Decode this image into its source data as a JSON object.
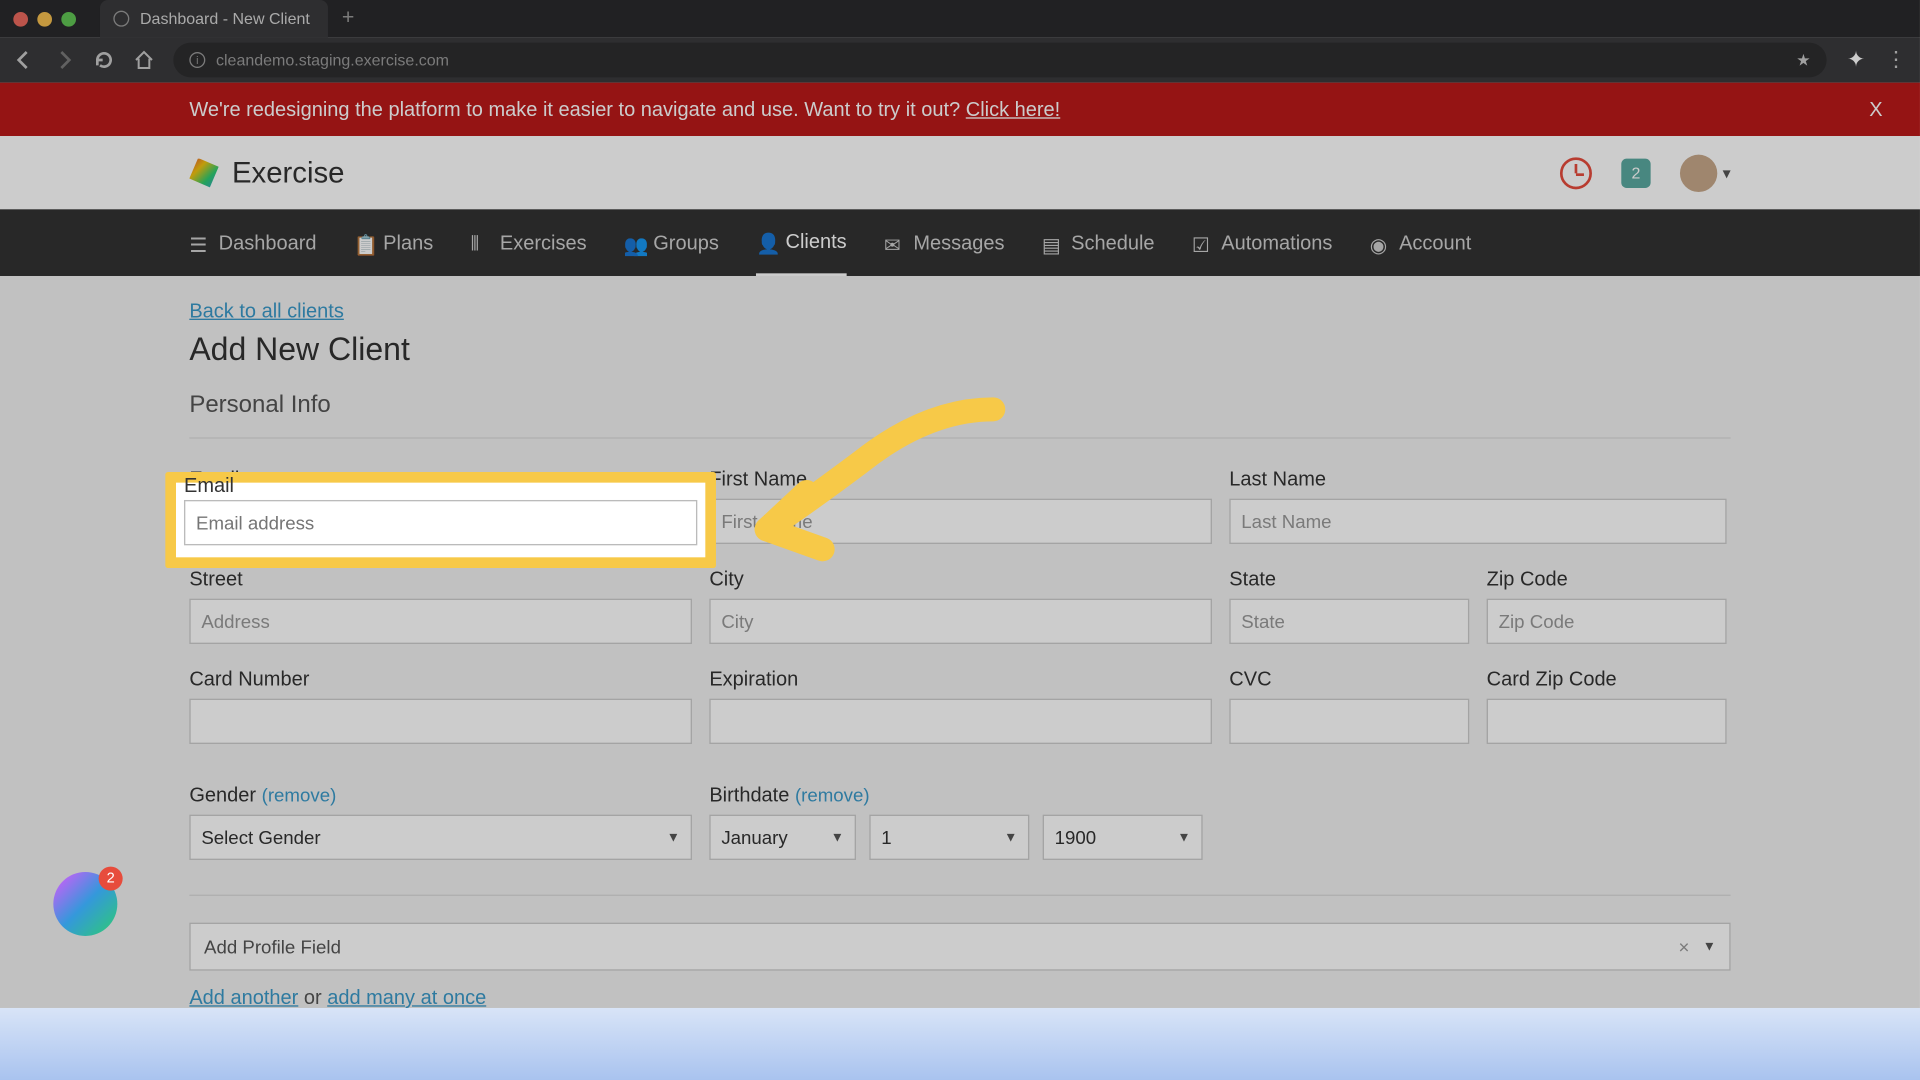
{
  "browser": {
    "tab_title": "Dashboard - New Client",
    "url": "cleandemo.staging.exercise.com",
    "traffic_colors": {
      "close": "#ec6a5e",
      "min": "#f5bf4f",
      "max": "#61c554"
    }
  },
  "banner": {
    "text": "We're redesigning the platform to make it easier to navigate and use. Want to try it out? ",
    "link": "Click here!",
    "close": "X"
  },
  "appbar": {
    "brand": "Exercise",
    "notif_count": "2"
  },
  "nav": {
    "items": [
      {
        "label": "Dashboard",
        "active": false
      },
      {
        "label": "Plans",
        "active": false
      },
      {
        "label": "Exercises",
        "active": false
      },
      {
        "label": "Groups",
        "active": false
      },
      {
        "label": "Clients",
        "active": true
      },
      {
        "label": "Messages",
        "active": false
      },
      {
        "label": "Schedule",
        "active": false
      },
      {
        "label": "Automations",
        "active": false
      },
      {
        "label": "Account",
        "active": false
      }
    ]
  },
  "page": {
    "back": "Back to all clients",
    "title": "Add New Client",
    "section": "Personal Info"
  },
  "form": {
    "email": {
      "label": "Email",
      "placeholder": "Email address"
    },
    "first_name": {
      "label": "First Name",
      "placeholder": "First Name"
    },
    "last_name": {
      "label": "Last Name",
      "placeholder": "Last Name"
    },
    "street": {
      "label": "Street",
      "placeholder": "Address"
    },
    "city": {
      "label": "City",
      "placeholder": "City"
    },
    "state": {
      "label": "State",
      "placeholder": "State"
    },
    "zip": {
      "label": "Zip Code",
      "placeholder": "Zip Code"
    },
    "card_number": {
      "label": "Card Number"
    },
    "expiration": {
      "label": "Expiration"
    },
    "cvc": {
      "label": "CVC"
    },
    "card_zip": {
      "label": "Card Zip Code"
    },
    "gender": {
      "label": "Gender",
      "remove": "(remove)",
      "selected": "Select Gender"
    },
    "birthdate": {
      "label": "Birthdate",
      "remove": "(remove)",
      "month": "January",
      "day": "1",
      "year": "1900"
    },
    "add_profile": "Add Profile Field",
    "add_another": "Add another",
    "or": " or ",
    "add_many": "add many at once"
  },
  "float_badge": "2"
}
